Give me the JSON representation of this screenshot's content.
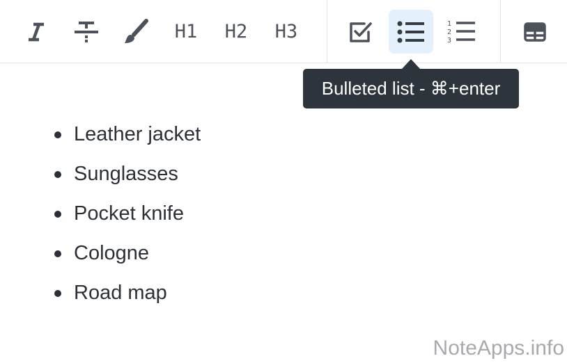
{
  "toolbar": {
    "buttons": [
      {
        "name": "italic",
        "icon": "italic-icon"
      },
      {
        "name": "strikethrough",
        "icon": "strikethrough-icon"
      },
      {
        "name": "highlight",
        "icon": "paintbrush-icon"
      },
      {
        "name": "heading-1",
        "label": "H1"
      },
      {
        "name": "heading-2",
        "label": "H2"
      },
      {
        "name": "heading-3",
        "label": "H3"
      },
      {
        "name": "checklist",
        "icon": "checkbox-icon"
      },
      {
        "name": "bulleted-list",
        "icon": "bulleted-list-icon",
        "active": true
      },
      {
        "name": "numbered-list",
        "icon": "numbered-list-icon"
      },
      {
        "name": "table",
        "icon": "table-icon"
      }
    ],
    "active_color": "#e4f1fc"
  },
  "tooltip": {
    "text": "Bulleted list - ⌘+enter"
  },
  "editor": {
    "items": [
      "Leather jacket",
      "Sunglasses",
      "Pocket knife",
      "Cologne",
      "Road map"
    ]
  },
  "watermark": {
    "text": "NoteApps.info"
  }
}
